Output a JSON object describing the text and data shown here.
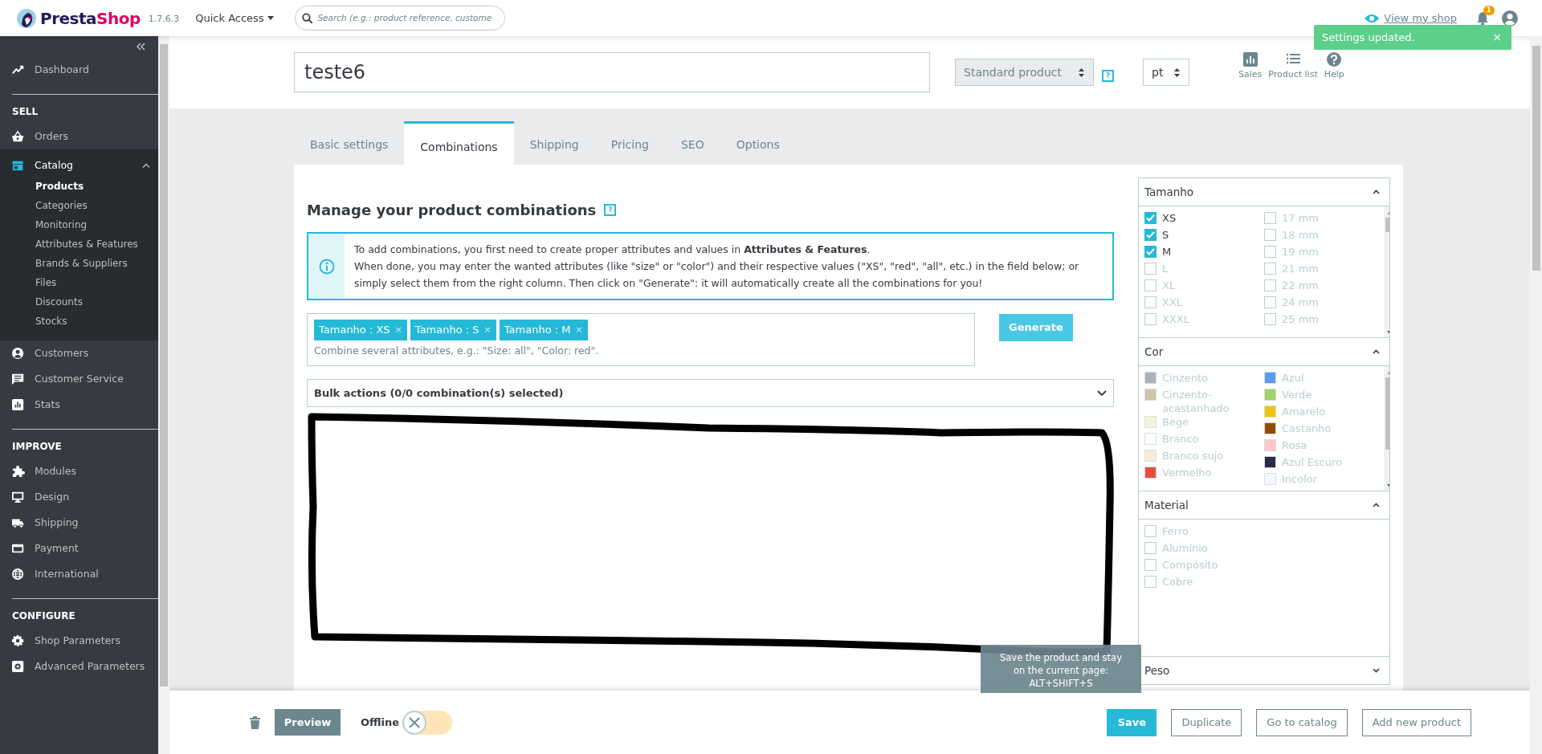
{
  "topbar": {
    "logo": [
      "Presta",
      "Shop"
    ],
    "version": "1.7.6.3",
    "quick_access": "Quick Access",
    "search": {
      "placeholder": "Search (e.g.: product reference, custome"
    },
    "view_shop": "View my shop",
    "notification_count": "1"
  },
  "toast": {
    "text": "Settings updated.",
    "close": "×"
  },
  "sidebar": {
    "groups": [
      {
        "items": [
          {
            "label": "Dashboard",
            "selected": false
          }
        ]
      },
      {
        "heading": "SELL",
        "items": [
          {
            "label": "Orders",
            "selected": false
          },
          {
            "label": "Catalog",
            "selected": true,
            "expanded": true,
            "children": [
              {
                "label": "Products",
                "selected": true
              },
              {
                "label": "Categories",
                "selected": false
              },
              {
                "label": "Monitoring",
                "selected": false
              },
              {
                "label": "Attributes & Features",
                "selected": false
              },
              {
                "label": "Brands & Suppliers",
                "selected": false
              },
              {
                "label": "Files",
                "selected": false
              },
              {
                "label": "Discounts",
                "selected": false
              },
              {
                "label": "Stocks",
                "selected": false
              }
            ]
          },
          {
            "label": "Customers",
            "selected": false
          },
          {
            "label": "Customer Service",
            "selected": false
          },
          {
            "label": "Stats",
            "selected": false
          }
        ]
      },
      {
        "heading": "IMPROVE",
        "items": [
          {
            "label": "Modules",
            "selected": false
          },
          {
            "label": "Design",
            "selected": false
          },
          {
            "label": "Shipping",
            "selected": false
          },
          {
            "label": "Payment",
            "selected": false
          },
          {
            "label": "International",
            "selected": false
          }
        ]
      },
      {
        "heading": "CONFIGURE",
        "items": [
          {
            "label": "Shop Parameters",
            "selected": false
          },
          {
            "label": "Advanced Parameters",
            "selected": false
          }
        ]
      }
    ]
  },
  "header": {
    "product_name": "teste6",
    "product_type": "Standard product",
    "help": "?",
    "language": "pt",
    "actions": [
      {
        "label": "Sales"
      },
      {
        "label": "Product list"
      },
      {
        "label": "Help"
      }
    ]
  },
  "tabs": [
    {
      "label": "Basic settings",
      "selected": false
    },
    {
      "label": "Combinations",
      "selected": true
    },
    {
      "label": "Shipping",
      "selected": false
    },
    {
      "label": "Pricing",
      "selected": false
    },
    {
      "label": "SEO",
      "selected": false
    },
    {
      "label": "Options",
      "selected": false
    }
  ],
  "combinations": {
    "title": "Manage your product combinations",
    "help": "?",
    "info": [
      "To add combinations, you first need to create proper attributes and values in **Attributes & Features**.",
      "When done, you may enter the wanted attributes (like \"size\" or \"color\") and their respective values (\"XS\", \"red\", \"all\", etc.) in the field below; or simply select them from the right column. Then click on \"Generate\": it will automatically create all the combinations for you!"
    ],
    "tags": [
      {
        "label": "Tamanho : XS",
        "remove": "×"
      },
      {
        "label": "Tamanho : S",
        "remove": "×"
      },
      {
        "label": "Tamanho : M",
        "remove": "×"
      }
    ],
    "tag_field": {
      "placeholder": "Combine several attributes, e.g.: \"Size: all\", \"Color: red\"."
    },
    "generate": "Generate",
    "bulk_actions": "Bulk actions (0/0 combination(s) selected)"
  },
  "attributes": {
    "groups": [
      {
        "title": "Tamanho",
        "expanded": true,
        "kind": "checkbox",
        "columns": [
          [
            {
              "label": "XS",
              "checked": true
            },
            {
              "label": "S",
              "checked": true
            },
            {
              "label": "M",
              "checked": true
            },
            {
              "label": "L",
              "checked": false
            },
            {
              "label": "XL",
              "checked": false
            },
            {
              "label": "XXL",
              "checked": false
            },
            {
              "label": "XXXL",
              "checked": false
            }
          ],
          [
            {
              "label": "17 mm",
              "checked": false
            },
            {
              "label": "18 mm",
              "checked": false
            },
            {
              "label": "19 mm",
              "checked": false
            },
            {
              "label": "21 mm",
              "checked": false
            },
            {
              "label": "22 mm",
              "checked": false
            },
            {
              "label": "24 mm",
              "checked": false
            },
            {
              "label": "25 mm",
              "checked": false
            }
          ]
        ]
      },
      {
        "title": "Cor",
        "expanded": true,
        "kind": "color",
        "columns": [
          [
            {
              "label": "Cinzento",
              "color": "#aab2bd"
            },
            {
              "label": "Cinzento-acastanhado",
              "color": "#cfc4a6"
            },
            {
              "label": "Bege",
              "color": "#f5f5dc"
            },
            {
              "label": "Branco",
              "color": "#ffffff"
            },
            {
              "label": "Branco sujo",
              "color": "#faebd7"
            },
            {
              "label": "Vermelho",
              "color": "#e84c3d"
            }
          ],
          [
            {
              "label": "Azul",
              "color": "#5d9cec"
            },
            {
              "label": "Verde",
              "color": "#a0d468"
            },
            {
              "label": "Amarelo",
              "color": "#f1c40f"
            },
            {
              "label": "Castanho",
              "color": "#964b00"
            },
            {
              "label": "Rosa",
              "color": "#fcc8c8"
            },
            {
              "label": "Azul Escuro",
              "color": "#2c2c44"
            },
            {
              "label": "Incolor",
              "color": "#f5f9ff"
            }
          ]
        ]
      },
      {
        "title": "Material",
        "expanded": true,
        "kind": "checkbox",
        "columns": [
          [
            {
              "label": "Ferro",
              "checked": false
            },
            {
              "label": "Alumínio",
              "checked": false
            },
            {
              "label": "Compósito",
              "checked": false
            },
            {
              "label": "Cobre",
              "checked": false
            }
          ]
        ]
      },
      {
        "title": "Peso",
        "expanded": false
      }
    ]
  },
  "bottom_bar": {
    "preview": "Preview",
    "status": {
      "label": "Offline",
      "on": false
    },
    "buttons": [
      {
        "label": "Save",
        "kind": "primary"
      },
      {
        "label": "Duplicate",
        "kind": "outline"
      },
      {
        "label": "Go to catalog",
        "kind": "outline"
      },
      {
        "label": "Add new product",
        "kind": "outline"
      }
    ],
    "tooltip": [
      "Save the product and stay",
      "on the current page:",
      "ALT+SHIFT+S"
    ]
  }
}
